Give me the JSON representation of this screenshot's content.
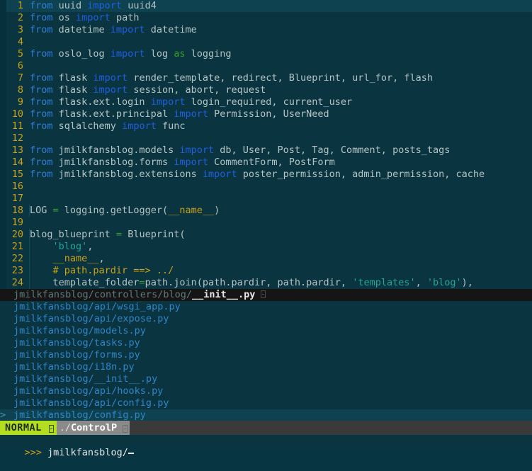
{
  "app": {
    "name": "vim",
    "mode": "NORMAL",
    "colors": {
      "background": "#0a3440",
      "signcolumn": "#06303b",
      "cursorline": "#0e4251",
      "linenumber": "#c8a21a",
      "keyword_from": "#2f7fd8",
      "keyword_import": "#1f5fe0",
      "keyword_as": "#3a9e28",
      "string": "#24a59a",
      "comment": "#c8a21a",
      "identifier": "#b5c4c4",
      "mode_badge": "#b3de20",
      "statusline": "#8a8a8a",
      "ctrlp_selected": "#151515",
      "ctrlp_item": "#2f86c9",
      "prompt": "#d89c1a"
    }
  },
  "editor": {
    "lines": [
      {
        "num": "1",
        "cursorline": true,
        "indent_guide": false,
        "tokens": [
          {
            "t": "from",
            "c": "k-from"
          },
          {
            "t": " uuid ",
            "c": "id"
          },
          {
            "t": "import",
            "c": "k-import"
          },
          {
            "t": " uuid4",
            "c": "id"
          }
        ]
      },
      {
        "num": "2",
        "cursorline": false,
        "indent_guide": false,
        "tokens": [
          {
            "t": "from",
            "c": "k-from"
          },
          {
            "t": " os ",
            "c": "id"
          },
          {
            "t": "import",
            "c": "k-import"
          },
          {
            "t": " path",
            "c": "id"
          }
        ]
      },
      {
        "num": "3",
        "cursorline": false,
        "indent_guide": false,
        "tokens": [
          {
            "t": "from",
            "c": "k-from"
          },
          {
            "t": " datetime ",
            "c": "id"
          },
          {
            "t": "import",
            "c": "k-import"
          },
          {
            "t": " datetime",
            "c": "id"
          }
        ]
      },
      {
        "num": "4",
        "cursorline": false,
        "indent_guide": false,
        "tokens": []
      },
      {
        "num": "5",
        "cursorline": false,
        "indent_guide": false,
        "tokens": [
          {
            "t": "from",
            "c": "k-from"
          },
          {
            "t": " oslo_log ",
            "c": "id"
          },
          {
            "t": "import",
            "c": "k-import"
          },
          {
            "t": " log ",
            "c": "id"
          },
          {
            "t": "as",
            "c": "k-as"
          },
          {
            "t": " logging",
            "c": "id"
          }
        ]
      },
      {
        "num": "6",
        "cursorline": false,
        "indent_guide": false,
        "tokens": []
      },
      {
        "num": "7",
        "cursorline": false,
        "indent_guide": false,
        "tokens": [
          {
            "t": "from",
            "c": "k-from"
          },
          {
            "t": " flask ",
            "c": "id"
          },
          {
            "t": "import",
            "c": "k-import"
          },
          {
            "t": " render_template, redirect, Blueprint, url_for, flash",
            "c": "id"
          }
        ]
      },
      {
        "num": "8",
        "cursorline": false,
        "indent_guide": false,
        "tokens": [
          {
            "t": "from",
            "c": "k-from"
          },
          {
            "t": " flask ",
            "c": "id"
          },
          {
            "t": "import",
            "c": "k-import"
          },
          {
            "t": " session, abort, request",
            "c": "id"
          }
        ]
      },
      {
        "num": "9",
        "cursorline": false,
        "indent_guide": false,
        "tokens": [
          {
            "t": "from",
            "c": "k-from"
          },
          {
            "t": " flask.ext.login ",
            "c": "id"
          },
          {
            "t": "import",
            "c": "k-import"
          },
          {
            "t": " login_required, current_user",
            "c": "id"
          }
        ]
      },
      {
        "num": "10",
        "cursorline": false,
        "indent_guide": false,
        "tokens": [
          {
            "t": "from",
            "c": "k-from"
          },
          {
            "t": " flask.ext.principal ",
            "c": "id"
          },
          {
            "t": "import",
            "c": "k-import"
          },
          {
            "t": " Permission, UserNeed",
            "c": "id"
          }
        ]
      },
      {
        "num": "11",
        "cursorline": false,
        "indent_guide": false,
        "tokens": [
          {
            "t": "from",
            "c": "k-from"
          },
          {
            "t": " sqlalchemy ",
            "c": "id"
          },
          {
            "t": "import",
            "c": "k-import"
          },
          {
            "t": " func",
            "c": "id"
          }
        ]
      },
      {
        "num": "12",
        "cursorline": false,
        "indent_guide": false,
        "tokens": []
      },
      {
        "num": "13",
        "cursorline": false,
        "indent_guide": false,
        "tokens": [
          {
            "t": "from",
            "c": "k-from"
          },
          {
            "t": " jmilkfansblog.models ",
            "c": "id"
          },
          {
            "t": "import",
            "c": "k-import"
          },
          {
            "t": " db, User, Post, Tag, Comment, posts_tags",
            "c": "id"
          }
        ]
      },
      {
        "num": "14",
        "cursorline": false,
        "indent_guide": false,
        "tokens": [
          {
            "t": "from",
            "c": "k-from"
          },
          {
            "t": " jmilkfansblog.forms ",
            "c": "id"
          },
          {
            "t": "import",
            "c": "k-import"
          },
          {
            "t": " CommentForm, PostForm",
            "c": "id"
          }
        ]
      },
      {
        "num": "15",
        "cursorline": false,
        "indent_guide": false,
        "tokens": [
          {
            "t": "from",
            "c": "k-from"
          },
          {
            "t": " jmilkfansblog.extensions ",
            "c": "id"
          },
          {
            "t": "import",
            "c": "k-import"
          },
          {
            "t": " poster_permission, admin_permission, cache",
            "c": "id"
          }
        ]
      },
      {
        "num": "16",
        "cursorline": false,
        "indent_guide": false,
        "tokens": []
      },
      {
        "num": "17",
        "cursorline": false,
        "indent_guide": false,
        "tokens": []
      },
      {
        "num": "18",
        "cursorline": false,
        "indent_guide": true,
        "tokens": [
          {
            "t": "LOG ",
            "c": "id"
          },
          {
            "t": "=",
            "c": "k-op"
          },
          {
            "t": " logging.getLogger(",
            "c": "id"
          },
          {
            "t": "__name__",
            "c": "dunder"
          },
          {
            "t": ")",
            "c": "punct"
          }
        ]
      },
      {
        "num": "19",
        "cursorline": false,
        "indent_guide": false,
        "tokens": []
      },
      {
        "num": "20",
        "cursorline": false,
        "indent_guide": true,
        "tokens": [
          {
            "t": "blog_blueprint ",
            "c": "id"
          },
          {
            "t": "=",
            "c": "k-op"
          },
          {
            "t": " Blueprint(",
            "c": "id"
          }
        ]
      },
      {
        "num": "21",
        "cursorline": false,
        "indent_guide": true,
        "tokens": [
          {
            "t": "    ",
            "c": "id"
          },
          {
            "t": "'blog'",
            "c": "str"
          },
          {
            "t": ",",
            "c": "punct"
          }
        ]
      },
      {
        "num": "22",
        "cursorline": false,
        "indent_guide": true,
        "tokens": [
          {
            "t": "    ",
            "c": "id"
          },
          {
            "t": "__name__",
            "c": "dunder"
          },
          {
            "t": ",",
            "c": "punct"
          }
        ]
      },
      {
        "num": "23",
        "cursorline": false,
        "indent_guide": true,
        "tokens": [
          {
            "t": "    ",
            "c": "id"
          },
          {
            "t": "# path.pardir ==> ../",
            "c": "comment"
          }
        ]
      },
      {
        "num": "24",
        "cursorline": false,
        "indent_guide": true,
        "tokens": [
          {
            "t": "    template_folder",
            "c": "id"
          },
          {
            "t": "=",
            "c": "k-op"
          },
          {
            "t": "path.join(path.pardir, path.pardir, ",
            "c": "id"
          },
          {
            "t": "'templates'",
            "c": "str"
          },
          {
            "t": ", ",
            "c": "punct"
          },
          {
            "t": "'blog'",
            "c": "str"
          },
          {
            "t": "),",
            "c": "punct"
          }
        ]
      }
    ]
  },
  "ctrlp": {
    "items": [
      {
        "sign": "",
        "prefix": "jmilkfansblog/controllers/blog/",
        "bold": "__init__.py",
        "selected": true,
        "cursor": false,
        "glyph": true
      },
      {
        "sign": "",
        "prefix": "jmilkfansblog/api/wsgi_app.py",
        "bold": "",
        "selected": false,
        "cursor": false,
        "glyph": false
      },
      {
        "sign": "",
        "prefix": "jmilkfansblog/api/expose.py",
        "bold": "",
        "selected": false,
        "cursor": false,
        "glyph": false
      },
      {
        "sign": "",
        "prefix": "jmilkfansblog/models.py",
        "bold": "",
        "selected": false,
        "cursor": false,
        "glyph": false
      },
      {
        "sign": "",
        "prefix": "jmilkfansblog/tasks.py",
        "bold": "",
        "selected": false,
        "cursor": false,
        "glyph": false
      },
      {
        "sign": "",
        "prefix": "jmilkfansblog/forms.py",
        "bold": "",
        "selected": false,
        "cursor": false,
        "glyph": false
      },
      {
        "sign": "",
        "prefix": "jmilkfansblog/i18n.py",
        "bold": "",
        "selected": false,
        "cursor": false,
        "glyph": false
      },
      {
        "sign": "",
        "prefix": "jmilkfansblog/__init__.py",
        "bold": "",
        "selected": false,
        "cursor": false,
        "glyph": false
      },
      {
        "sign": "",
        "prefix": "jmilkfansblog/api/hooks.py",
        "bold": "",
        "selected": false,
        "cursor": false,
        "glyph": false
      },
      {
        "sign": "",
        "prefix": "jmilkfansblog/api/config.py",
        "bold": "",
        "selected": false,
        "cursor": false,
        "glyph": false
      },
      {
        "sign": ">",
        "prefix": "jmilkfansblog/config.py",
        "bold": "",
        "selected": false,
        "cursor": true,
        "glyph": false
      }
    ]
  },
  "statusline": {
    "mode": "NORMAL",
    "path_prefix": "./",
    "path_name": "ControlP"
  },
  "cmdline": {
    "prompt": ">>>",
    "text": " jmilkfansblog/"
  }
}
